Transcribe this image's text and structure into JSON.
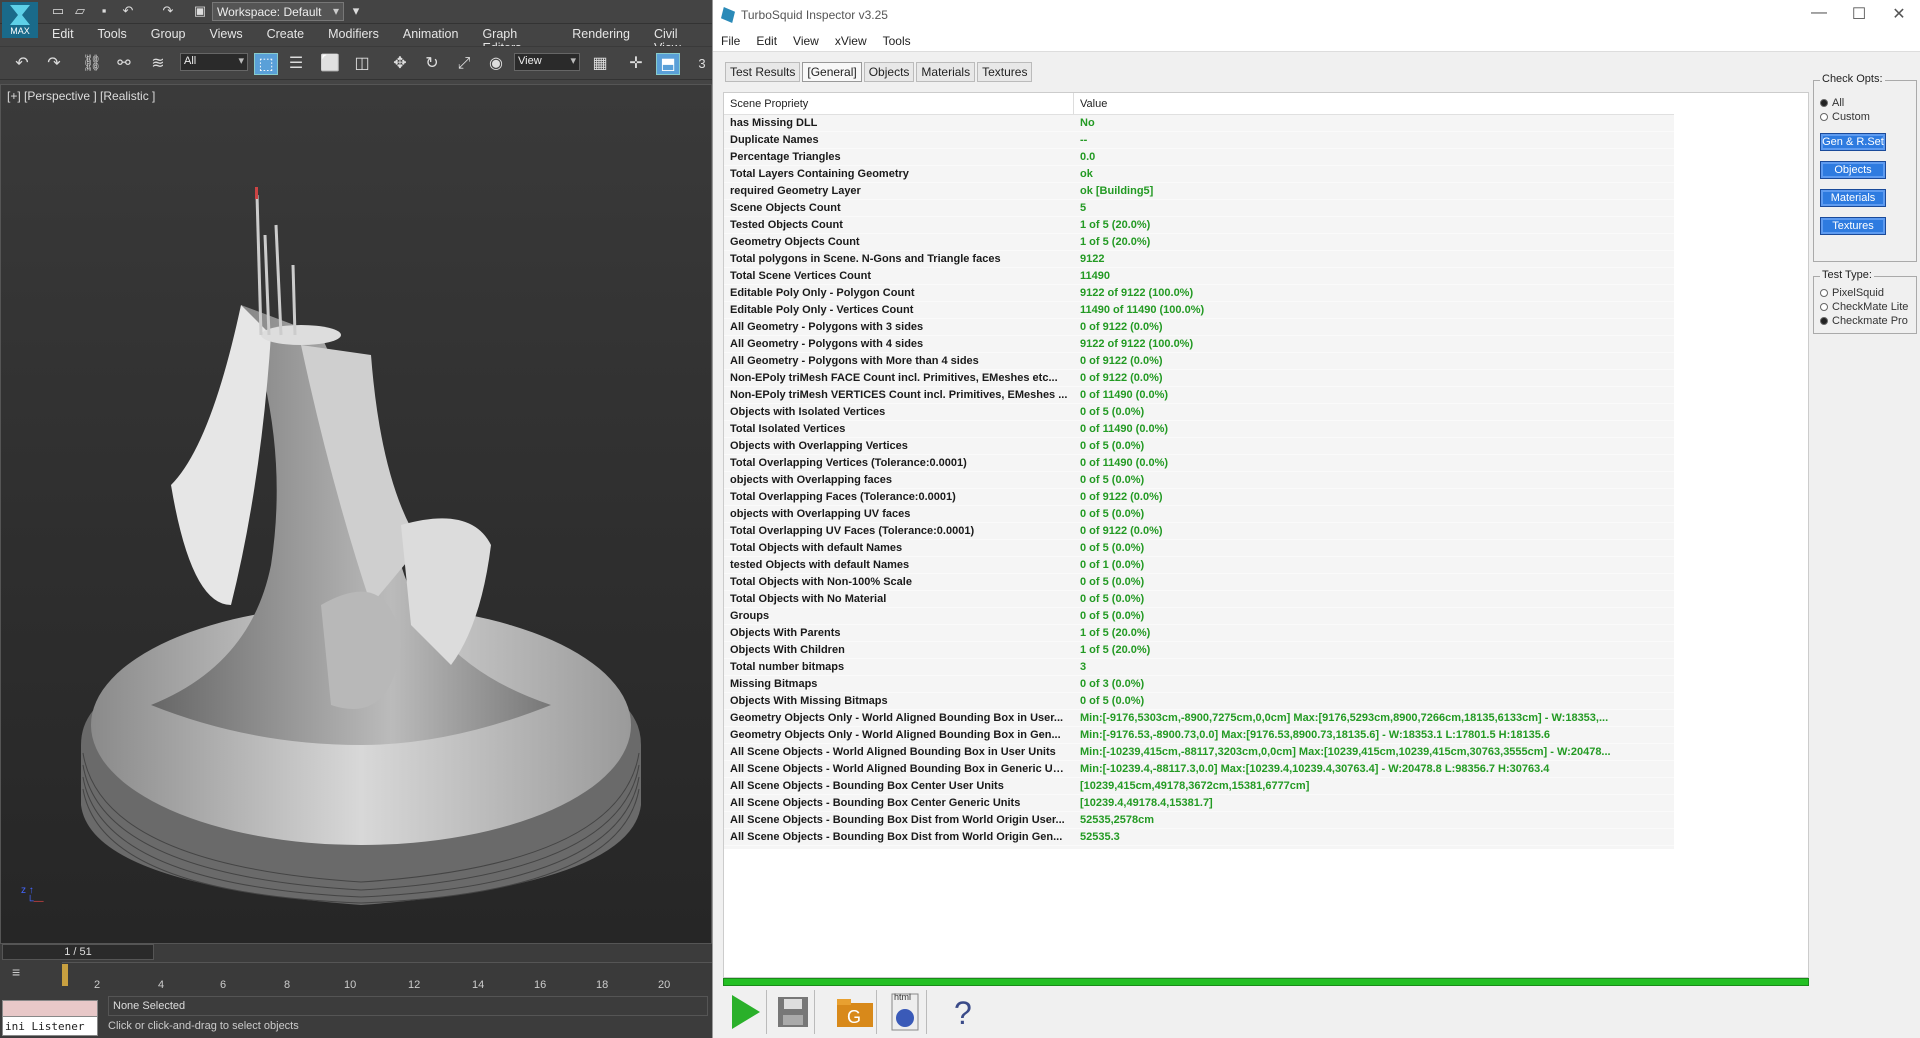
{
  "max": {
    "logo_text": "MAX",
    "workspace": "Workspace: Default",
    "menu": [
      "Edit",
      "Tools",
      "Group",
      "Views",
      "Create",
      "Modifiers",
      "Animation",
      "Graph Editors",
      "Rendering",
      "Civil View"
    ],
    "selection_filter": "All",
    "ref_coord": "View",
    "snap_count": "3",
    "viewport_label": "[+] [Perspective ] [Realistic ]",
    "frame_slider": "1 / 51",
    "timeline_ticks": [
      "2",
      "4",
      "6",
      "8",
      "10",
      "12",
      "14",
      "16",
      "18",
      "20"
    ],
    "listener": "ini Listener",
    "status_selection": "None Selected",
    "status_prompt": "Click or click-and-drag to select objects"
  },
  "tsi": {
    "title": "TurboSquid Inspector v3.25",
    "menu": [
      "File",
      "Edit",
      "View",
      "xView",
      "Tools"
    ],
    "tabs": [
      "Test Results",
      "[General]",
      "Objects",
      "Materials",
      "Textures"
    ],
    "col_property": "Scene Propriety",
    "col_value": "Value",
    "rows": [
      {
        "p": "has Missing DLL",
        "v": "No"
      },
      {
        "p": "Duplicate Names",
        "v": "--"
      },
      {
        "p": "Percentage Triangles",
        "v": "0.0"
      },
      {
        "p": "Total Layers Containing Geometry",
        "v": "ok"
      },
      {
        "p": "required Geometry Layer",
        "v": "ok [Building5]"
      },
      {
        "p": "Scene Objects Count",
        "v": "5"
      },
      {
        "p": "Tested Objects Count",
        "v": "1 of 5 (20.0%)"
      },
      {
        "p": "Geometry Objects Count",
        "v": "1 of 5 (20.0%)"
      },
      {
        "p": "Total polygons in Scene. N-Gons and Triangle faces",
        "v": "9122"
      },
      {
        "p": "Total Scene Vertices Count",
        "v": "11490"
      },
      {
        "p": "Editable Poly Only - Polygon Count",
        "v": "9122 of 9122 (100.0%)"
      },
      {
        "p": "Editable Poly Only - Vertices Count",
        "v": "11490 of 11490 (100.0%)"
      },
      {
        "p": "All Geometry - Polygons with 3 sides",
        "v": "0 of 9122 (0.0%)"
      },
      {
        "p": "All Geometry - Polygons with 4 sides",
        "v": "9122 of 9122 (100.0%)"
      },
      {
        "p": "All Geometry - Polygons with More than 4 sides",
        "v": "0 of 9122 (0.0%)"
      },
      {
        "p": "Non-EPoly triMesh FACE Count incl. Primitives, EMeshes etc...",
        "v": "0 of 9122 (0.0%)"
      },
      {
        "p": "Non-EPoly triMesh VERTICES Count incl. Primitives, EMeshes ...",
        "v": "0 of 11490 (0.0%)"
      },
      {
        "p": "Objects with Isolated Vertices",
        "v": "0 of 5 (0.0%)"
      },
      {
        "p": "Total Isolated Vertices",
        "v": "0 of 11490 (0.0%)"
      },
      {
        "p": "Objects with Overlapping Vertices",
        "v": "0 of 5 (0.0%)"
      },
      {
        "p": "Total Overlapping Vertices (Tolerance:0.0001)",
        "v": "0 of 11490 (0.0%)"
      },
      {
        "p": "objects with Overlapping faces",
        "v": "0 of 5 (0.0%)"
      },
      {
        "p": "Total Overlapping Faces (Tolerance:0.0001)",
        "v": "0 of 9122 (0.0%)"
      },
      {
        "p": "objects with Overlapping UV faces",
        "v": "0 of 5 (0.0%)"
      },
      {
        "p": "Total Overlapping UV Faces (Tolerance:0.0001)",
        "v": "0 of 9122 (0.0%)"
      },
      {
        "p": "Total Objects with default Names",
        "v": "0 of 5 (0.0%)"
      },
      {
        "p": "tested Objects with default Names",
        "v": "0 of 1 (0.0%)"
      },
      {
        "p": "Total Objects with Non-100% Scale",
        "v": "0 of 5 (0.0%)"
      },
      {
        "p": "Total Objects with No Material",
        "v": "0 of 5 (0.0%)"
      },
      {
        "p": "Groups",
        "v": "0 of 5 (0.0%)"
      },
      {
        "p": "Objects With Parents",
        "v": "1 of 5 (20.0%)"
      },
      {
        "p": "Objects With Children",
        "v": "1 of 5 (20.0%)"
      },
      {
        "p": "Total number bitmaps",
        "v": "3"
      },
      {
        "p": "Missing Bitmaps",
        "v": "0 of 3 (0.0%)"
      },
      {
        "p": "Objects With Missing Bitmaps",
        "v": "0 of 5 (0.0%)"
      },
      {
        "p": "Geometry Objects Only - World Aligned Bounding Box in User...",
        "v": "Min:[-9176,5303cm,-8900,7275cm,0,0cm]  Max:[9176,5293cm,8900,7266cm,18135,6133cm] - W:18353,..."
      },
      {
        "p": "Geometry Objects Only - World Aligned Bounding Box in Gen...",
        "v": "Min:[-9176.53,-8900.73,0.0]  Max:[9176.53,8900.73,18135.6] - W:18353.1 L:17801.5 H:18135.6"
      },
      {
        "p": "All Scene Objects - World Aligned Bounding Box in User Units",
        "v": "Min:[-10239,415cm,-88117,3203cm,0,0cm]  Max:[10239,415cm,10239,415cm,30763,3555cm] - W:20478..."
      },
      {
        "p": "All Scene Objects - World Aligned Bounding Box in Generic Un...",
        "v": "Min:[-10239.4,-88117.3,0.0]  Max:[10239.4,10239.4,30763.4] - W:20478.8 L:98356.7 H:30763.4"
      },
      {
        "p": "All Scene Objects - Bounding Box Center User Units",
        "v": "[10239,415cm,49178,3672cm,15381,6777cm]"
      },
      {
        "p": "All Scene Objects - Bounding Box Center Generic Units",
        "v": "[10239.4,49178.4,15381.7]"
      },
      {
        "p": "All Scene Objects - Bounding Box Dist from World Origin User...",
        "v": "52535,2578cm"
      },
      {
        "p": "All Scene Objects - Bounding Box Dist from World Origin Gen...",
        "v": "52535.3"
      }
    ],
    "check_opts_title": "Check Opts:",
    "check_opts": [
      "All",
      "Custom"
    ],
    "buttons": [
      "Gen & R.Set",
      "Objects",
      "Materials",
      "Textures"
    ],
    "test_type_title": "Test Type:",
    "test_types": [
      "PixelSquid",
      "CheckMate Lite",
      "Checkmate Pro"
    ],
    "html_icon_text": "html"
  }
}
